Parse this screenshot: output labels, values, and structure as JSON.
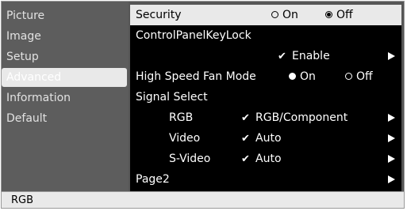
{
  "sidebar": {
    "items": [
      {
        "label": "Picture"
      },
      {
        "label": "Image"
      },
      {
        "label": "Setup"
      },
      {
        "label": "Advanced"
      },
      {
        "label": "Information"
      },
      {
        "label": "Default"
      }
    ],
    "active": "Advanced"
  },
  "menu": {
    "security": {
      "label": "Security",
      "on": "On",
      "off": "Off",
      "selected": "Off"
    },
    "control_panel_key_lock": {
      "label": "ControlPanelKeyLock",
      "value": "Enable"
    },
    "fan_mode": {
      "label": "High Speed Fan Mode",
      "on": "On",
      "off": "Off",
      "selected": "On"
    },
    "signal_select": {
      "label": "Signal Select"
    },
    "rgb": {
      "label": "RGB",
      "value": "RGB/Component"
    },
    "video": {
      "label": "Video",
      "value": "Auto"
    },
    "svideo": {
      "label": "S-Video",
      "value": "Auto"
    },
    "page2": {
      "label": "Page2"
    }
  },
  "status": {
    "text": "RGB"
  },
  "icons": {
    "check": "✔",
    "arrow": "right-arrow-icon",
    "radio": "radio-icon"
  },
  "colors": {
    "highlight": "#e9e9e9",
    "menu_bg": "#000000",
    "frame_bg": "#565656",
    "text": "#ffffff"
  }
}
